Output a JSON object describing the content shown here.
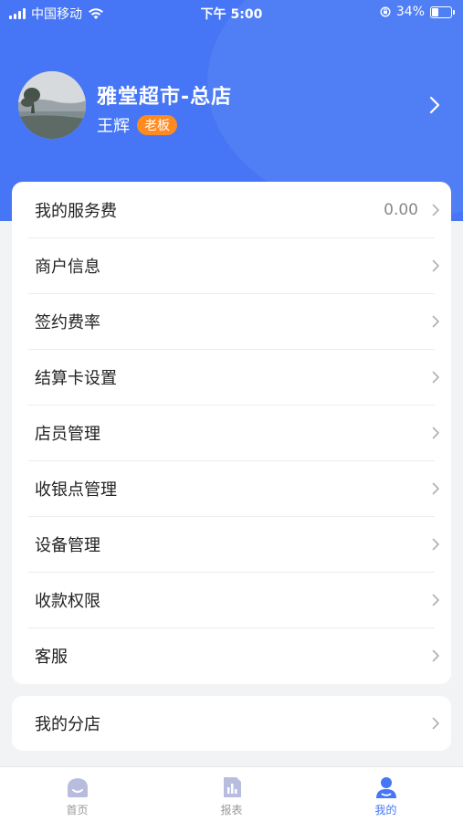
{
  "status_bar": {
    "carrier": "中国移动",
    "time": "下午 5:00",
    "battery": "34%",
    "battery_level": 0.34
  },
  "profile": {
    "store_name": "雅堂超市-总店",
    "user_name": "王辉",
    "role_badge": "老板",
    "avatar_icon": "avatar-photo"
  },
  "menu": {
    "items": [
      {
        "label": "我的服务费",
        "value": "0.00"
      },
      {
        "label": "商户信息"
      },
      {
        "label": "签约费率"
      },
      {
        "label": "结算卡设置"
      },
      {
        "label": "店员管理"
      },
      {
        "label": "收银点管理"
      },
      {
        "label": "设备管理"
      },
      {
        "label": "收款权限"
      },
      {
        "label": "客服"
      }
    ],
    "branch": {
      "label": "我的分店"
    }
  },
  "tabbar": {
    "tabs": [
      {
        "label": "首页",
        "icon": "home-icon",
        "active": false
      },
      {
        "label": "报表",
        "icon": "report-icon",
        "active": false
      },
      {
        "label": "我的",
        "icon": "profile-icon",
        "active": true
      }
    ]
  },
  "colors": {
    "primary": "#4676f5",
    "badge": "#ff8a1f",
    "inactive_icon": "#b8bde0"
  }
}
